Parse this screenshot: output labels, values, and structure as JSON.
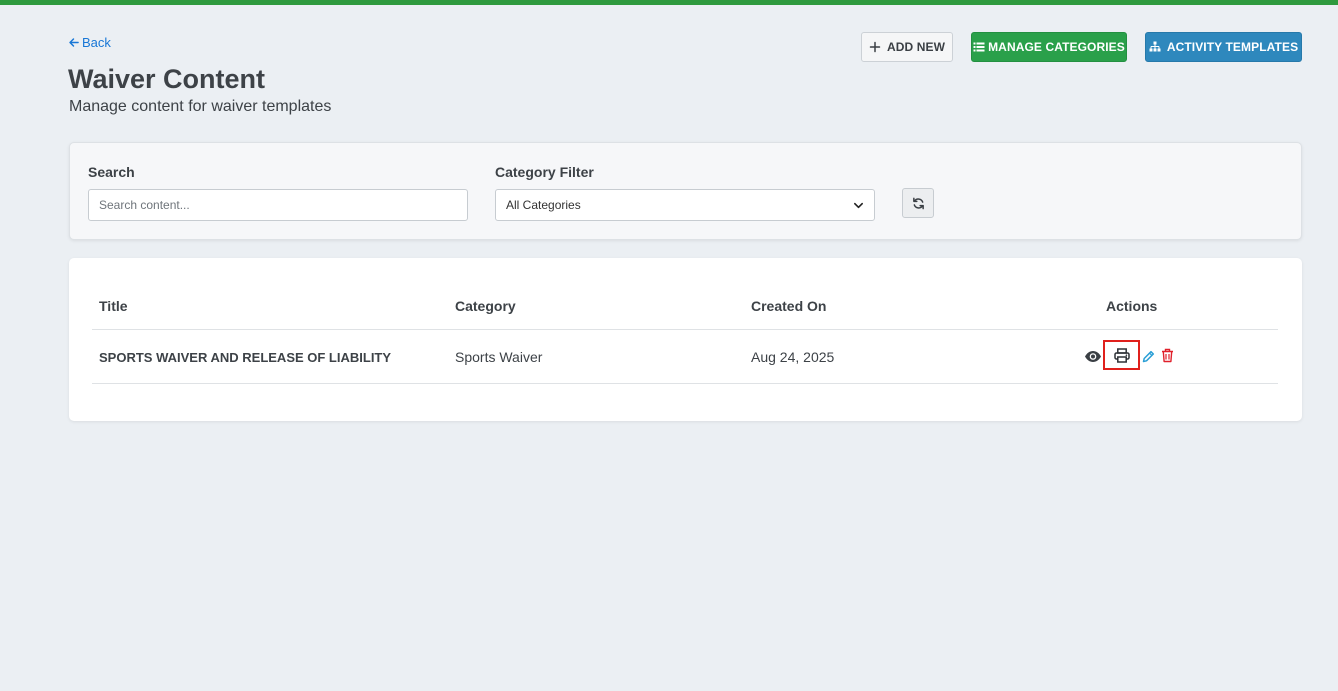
{
  "nav": {
    "back_label": "Back"
  },
  "header": {
    "title": "Waiver Content",
    "subtitle": "Manage content for waiver templates"
  },
  "toolbar": {
    "add_new_label": "ADD NEW",
    "manage_categories_label": "MANAGE CATEGORIES",
    "activity_templates_label": "ACTIVITY TEMPLATES"
  },
  "filters": {
    "search_label": "Search",
    "search_placeholder": "Search content...",
    "search_value": "",
    "category_label": "Category Filter",
    "category_selected": "All Categories"
  },
  "table": {
    "columns": [
      "Title",
      "Category",
      "Created On",
      "Actions"
    ],
    "rows": [
      {
        "title": "SPORTS WAIVER AND RELEASE OF LIABILITY",
        "category": "Sports Waiver",
        "created_on": "Aug 24, 2025"
      }
    ]
  },
  "icons": {
    "back": "arrow-left-icon",
    "add": "plus-icon",
    "manage_categories": "list-icon",
    "activity_templates": "sitemap-icon",
    "refresh": "refresh-icon",
    "select": "chevron-down-icon",
    "view": "eye-icon",
    "print": "print-icon",
    "edit": "pencil-icon",
    "delete": "trash-icon"
  },
  "colors": {
    "top_bar": "#2f9a3e",
    "link": "#1877d6",
    "manage_categories_bg": "#2aa04a",
    "activity_templates_bg": "#2e88bd",
    "edit_icon": "#2a9fd6",
    "delete_icon": "#e0202b",
    "highlight": "#e0201c"
  }
}
